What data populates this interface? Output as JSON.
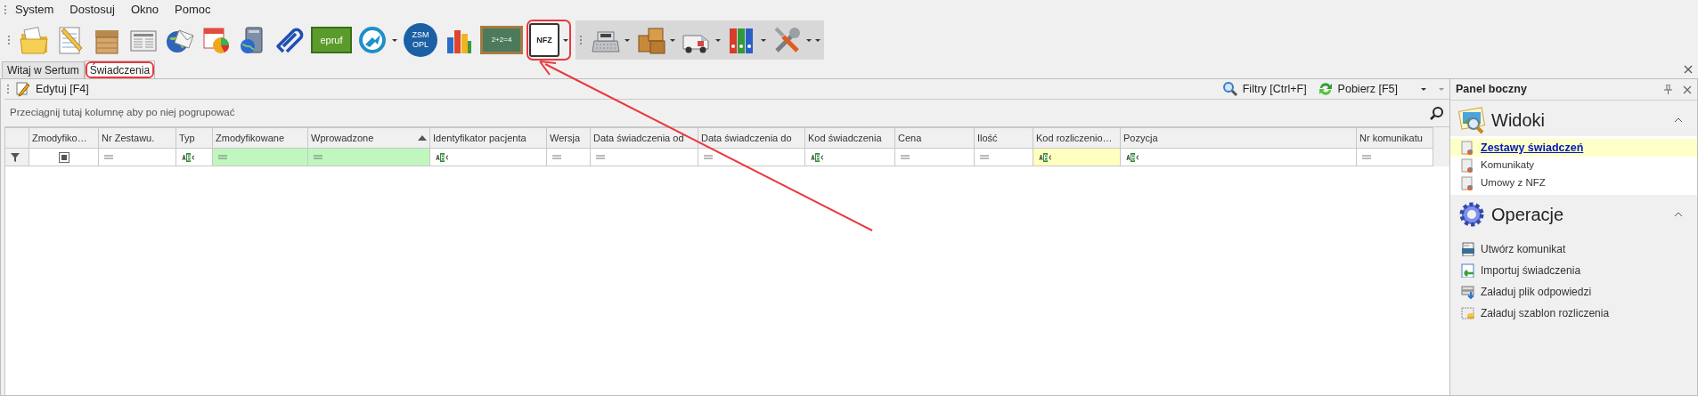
{
  "menu": [
    "System",
    "Dostosuj",
    "Okno",
    "Pomoc"
  ],
  "toolbar": {
    "groups": [
      {
        "shaded": false,
        "overflow": false,
        "items": [
          {
            "kind": "folders",
            "dropdown": false,
            "highlighted": false
          },
          {
            "kind": "notepad",
            "dropdown": false,
            "highlighted": false
          },
          {
            "kind": "box",
            "dropdown": false,
            "highlighted": false
          },
          {
            "kind": "newspaper",
            "dropdown": false,
            "highlighted": false
          },
          {
            "kind": "globe-mail",
            "dropdown": false,
            "highlighted": false
          },
          {
            "kind": "calendar-chart",
            "dropdown": false,
            "highlighted": false
          },
          {
            "kind": "pc-globe",
            "dropdown": false,
            "highlighted": false
          },
          {
            "kind": "paperclip",
            "dropdown": false,
            "highlighted": false
          },
          {
            "kind": "logo-green",
            "label": "epruf",
            "dropdown": false,
            "highlighted": false
          },
          {
            "kind": "blue-circle",
            "dropdown": true,
            "highlighted": false
          },
          {
            "kind": "logo-round",
            "label": "ZSM OPL",
            "dropdown": false,
            "highlighted": false
          },
          {
            "kind": "bars",
            "dropdown": false,
            "highlighted": false
          },
          {
            "kind": "chalkboard",
            "label": "2+2=4",
            "dropdown": false,
            "highlighted": false
          },
          {
            "kind": "document-coin",
            "label": "NFZ",
            "dropdown": true,
            "highlighted": true
          }
        ]
      },
      {
        "shaded": true,
        "overflow": true,
        "items": [
          {
            "kind": "register",
            "dropdown": true,
            "highlighted": false
          },
          {
            "kind": "boxes",
            "dropdown": true,
            "highlighted": false
          },
          {
            "kind": "van",
            "dropdown": true,
            "highlighted": false
          },
          {
            "kind": "binders",
            "dropdown": true,
            "highlighted": false
          },
          {
            "kind": "tools",
            "dropdown": true,
            "highlighted": false
          }
        ]
      }
    ]
  },
  "tabs": [
    {
      "label": "Witaj w Sertum",
      "selected": false,
      "highlighted": false
    },
    {
      "label": "Świadczenia",
      "selected": true,
      "highlighted": true
    }
  ],
  "edit_bar": {
    "left": [
      {
        "label": "Edytuj [F4]",
        "kind": "pencil"
      }
    ],
    "right": [
      {
        "label": "Filtry [Ctrl+F]",
        "kind": "magnifier"
      },
      {
        "label": "Pobierz [F5]",
        "kind": "refresh"
      }
    ]
  },
  "group_panel": {
    "hint": "Przeciągnij tutaj kolumnę aby po niej pogrupować"
  },
  "grid": {
    "columns": [
      {
        "label": "Zmodyfiko…",
        "kind": "checkbox",
        "sorted": false
      },
      {
        "label": "Nr Zestawu.",
        "kind": "equals",
        "sorted": false
      },
      {
        "label": "Typ",
        "kind": "abc",
        "sorted": false
      },
      {
        "label": "Zmodyfikowane",
        "kind": "equals",
        "color": "#bff7bf",
        "sorted": false
      },
      {
        "label": "Wprowadzone",
        "kind": "equals",
        "color": "#bff7bf",
        "sorted": true
      },
      {
        "label": "Identyfikator pacjenta",
        "kind": "abc",
        "sorted": false
      },
      {
        "label": "Wersja",
        "kind": "equals",
        "sorted": false
      },
      {
        "label": "Data świadczenia od",
        "kind": "equals",
        "sorted": false
      },
      {
        "label": "Data świadczenia do",
        "kind": "equals",
        "sorted": false
      },
      {
        "label": "Kod świadczenia",
        "kind": "abc",
        "sorted": false
      },
      {
        "label": "Cena",
        "kind": "equals",
        "sorted": false
      },
      {
        "label": "Ilość",
        "kind": "equals",
        "sorted": false
      },
      {
        "label": "Kod rozliczenio…",
        "kind": "abc",
        "color": "#ffffc0",
        "sorted": false
      },
      {
        "label": "Pozycja",
        "kind": "abc",
        "sorted": false
      },
      {
        "label": "Nr komunikatu",
        "kind": "equals",
        "sorted": false
      }
    ]
  },
  "side_panel": {
    "title": "Panel boczny",
    "sections": [
      {
        "title": "Widoki",
        "kind": "views",
        "expanded": true,
        "items": [
          {
            "label": "Zestawy świadczeń",
            "kind": "report",
            "selected": true
          },
          {
            "label": "Komunikaty",
            "kind": "report",
            "selected": false
          },
          {
            "label": "Umowy z NFZ",
            "kind": "report",
            "selected": false
          }
        ]
      },
      {
        "title": "Operacje",
        "kind": "gear",
        "expanded": true,
        "items": [
          {
            "label": "Utwórz komunikat",
            "kind": "xml",
            "selected": false
          },
          {
            "label": "Importuj świadczenia",
            "kind": "import",
            "selected": false
          },
          {
            "label": "Załaduj plik odpowiedzi",
            "kind": "download",
            "selected": false
          },
          {
            "label": "Załaduj szablon rozliczenia",
            "kind": "template",
            "selected": false
          }
        ]
      }
    ]
  },
  "pointer_arrow": true
}
